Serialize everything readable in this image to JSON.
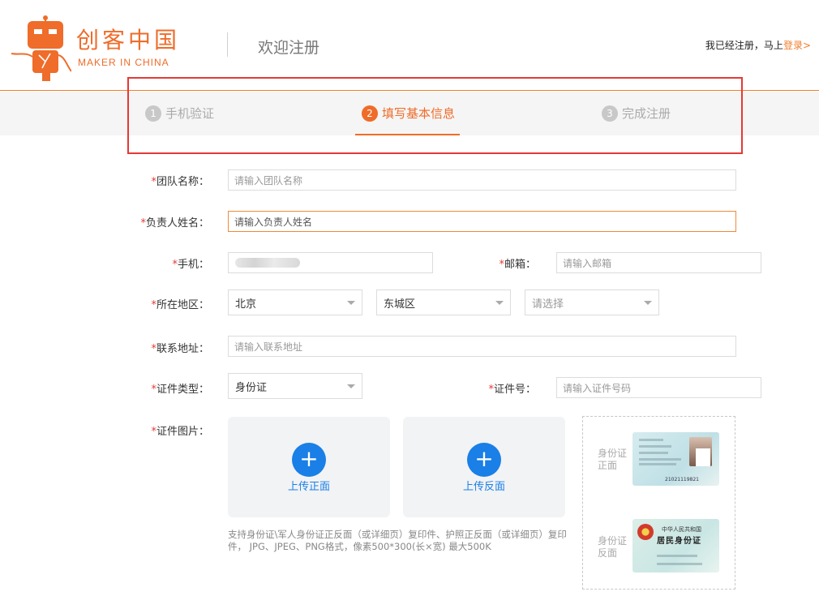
{
  "header": {
    "logo_cn": "创客中国",
    "logo_en": "MAKER IN CHINA",
    "title": "欢迎注册",
    "login_prompt": "我已经注册，马上",
    "login_link": "登录>",
    "brand_color": "#ef6c2a"
  },
  "steps": [
    {
      "num": "1",
      "label": "手机验证"
    },
    {
      "num": "2",
      "label": "填写基本信息"
    },
    {
      "num": "3",
      "label": "完成注册"
    }
  ],
  "active_step": 2,
  "form": {
    "required_mark": "*",
    "team_name": {
      "label": "团队名称：",
      "placeholder": "请输入团队名称"
    },
    "leader_name": {
      "label": "负责人姓名：",
      "placeholder": "请输入负责人姓名"
    },
    "phone": {
      "label": "手机："
    },
    "email": {
      "label": "邮箱：",
      "placeholder": "请输入邮箱"
    },
    "region": {
      "label": "所在地区：",
      "province": "北京",
      "district": "东城区",
      "street_placeholder": "请选择"
    },
    "address": {
      "label": "联系地址：",
      "placeholder": "请输入联系地址"
    },
    "id_type": {
      "label": "证件类型：",
      "value": "身份证"
    },
    "id_number": {
      "label": "证件号：",
      "placeholder": "请输入证件号码"
    },
    "id_images": {
      "label": "证件图片：",
      "upload_front": "上传正面",
      "upload_back": "上传反面",
      "plus_glyph": "+",
      "hint": "支持身份证\\军人身份证正反面（或详细页）复印件、护照正反面（或详细页）复印件， JPG、JPEG、PNG格式，像素500*300(长×宽) 最大500K",
      "sample_front_label": "身份证正面",
      "sample_back_label": "身份证反面",
      "sample_card_title1": "中华人民共和国",
      "sample_card_title2": "居民身份证",
      "sample_card_number": "21021119821"
    }
  }
}
